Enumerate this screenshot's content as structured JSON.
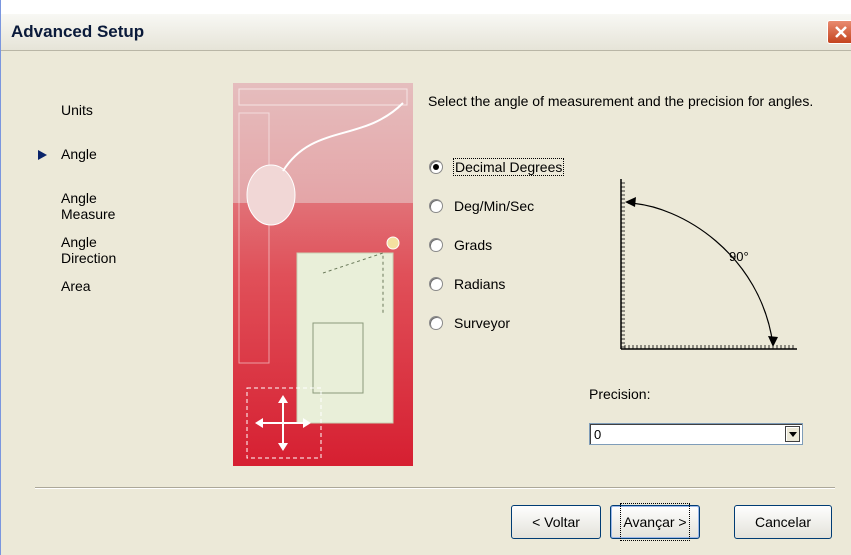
{
  "window": {
    "title": "Advanced Setup"
  },
  "steps": [
    {
      "label": "Units",
      "current": false
    },
    {
      "label": "Angle",
      "current": true
    },
    {
      "label": "Angle Measure",
      "current": false
    },
    {
      "label": "Angle Direction",
      "current": false
    },
    {
      "label": "Area",
      "current": false
    }
  ],
  "instruction": "Select the angle of measurement and the precision for angles.",
  "options": [
    {
      "label": "Decimal Degrees",
      "selected": true
    },
    {
      "label": "Deg/Min/Sec",
      "selected": false
    },
    {
      "label": "Grads",
      "selected": false
    },
    {
      "label": "Radians",
      "selected": false
    },
    {
      "label": "Surveyor",
      "selected": false
    }
  ],
  "diagram": {
    "angle_label": "90°"
  },
  "precision": {
    "label": "Precision:",
    "value": "0"
  },
  "buttons": {
    "back": "< Voltar",
    "next": "Avançar >",
    "cancel": "Cancelar"
  },
  "colors": {
    "accent": "#0a246a",
    "close": "#c4441f",
    "illustration": "#d9323f"
  }
}
